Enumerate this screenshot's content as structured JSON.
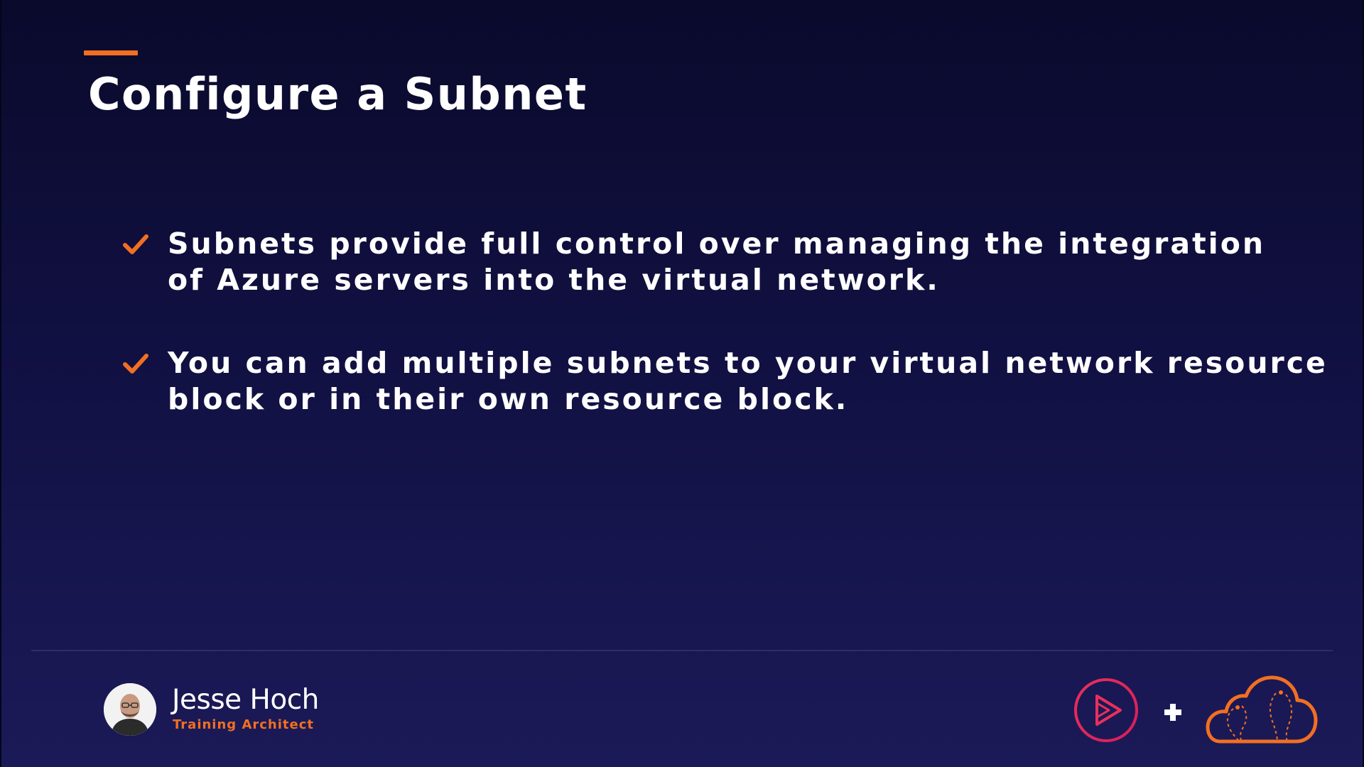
{
  "slide": {
    "title": "Configure a Subnet",
    "bullets": [
      {
        "lines": [
          "Subnets provide full control over managing the integration",
          "of Azure servers into the virtual network."
        ]
      },
      {
        "lines": [
          "You can add multiple subnets to your virtual network resource",
          "block or in their own resource block."
        ]
      }
    ]
  },
  "presenter": {
    "name": "Jesse Hoch",
    "role": "Training Architect"
  },
  "icons": {
    "bullet": "check-icon",
    "logo_left": "play-logo-icon",
    "separator": "plus-icon",
    "logo_right": "cloud-logo-icon"
  },
  "colors": {
    "accent": "#f26f21",
    "background_top": "#0a0a2c",
    "background_bottom": "#1b1a58",
    "play_logo": "#e8305a",
    "text": "#ffffff"
  }
}
